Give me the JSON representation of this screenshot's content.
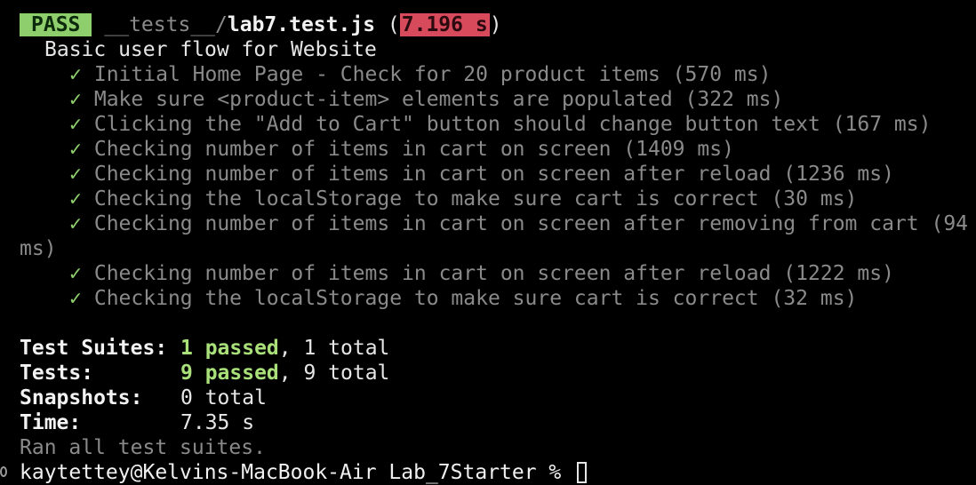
{
  "header": {
    "status": "PASS",
    "dir_prefix": "__tests__/",
    "file_name": "lab7.test.js",
    "open_paren": " (",
    "duration": "7.196 s",
    "close_paren": ")"
  },
  "suite": {
    "title": "Basic user flow for Website",
    "check_glyph": "✓",
    "tests": [
      "Initial Home Page - Check for 20 product items (570 ms)",
      "Make sure <product-item> elements are populated (322 ms)",
      "Clicking the \"Add to Cart\" button should change button text (167 ms)",
      "Checking number of items in cart on screen (1409 ms)",
      "Checking number of items in cart on screen after reload (1236 ms)",
      "Checking the localStorage to make sure cart is correct (30 ms)",
      "Checking number of items in cart on screen after removing from cart (94",
      "Checking number of items in cart on screen after reload (1222 ms)",
      "Checking the localStorage to make sure cart is correct (32 ms)"
    ],
    "wrap_continuation": "ms)"
  },
  "summary": {
    "suites_label": "Test Suites:",
    "suites_passed": "1 passed",
    "suites_total": ", 1 total",
    "tests_label": "Tests:",
    "tests_passed": "9 passed",
    "tests_total": ", 9 total",
    "snapshots_label": "Snapshots:",
    "snapshots_value": "0 total",
    "time_label": "Time:",
    "time_value": "7.35 s",
    "ran_all": "Ran all test suites."
  },
  "prompt": {
    "text": "kaytettey@Kelvins-MacBook-Air Lab_7Starter % "
  },
  "colors": {
    "background": "#000000",
    "pass_badge": "#8fce6c",
    "slow_badge": "#d64a5c",
    "dim_text": "#8a8a8a",
    "check": "#8fce6c"
  }
}
